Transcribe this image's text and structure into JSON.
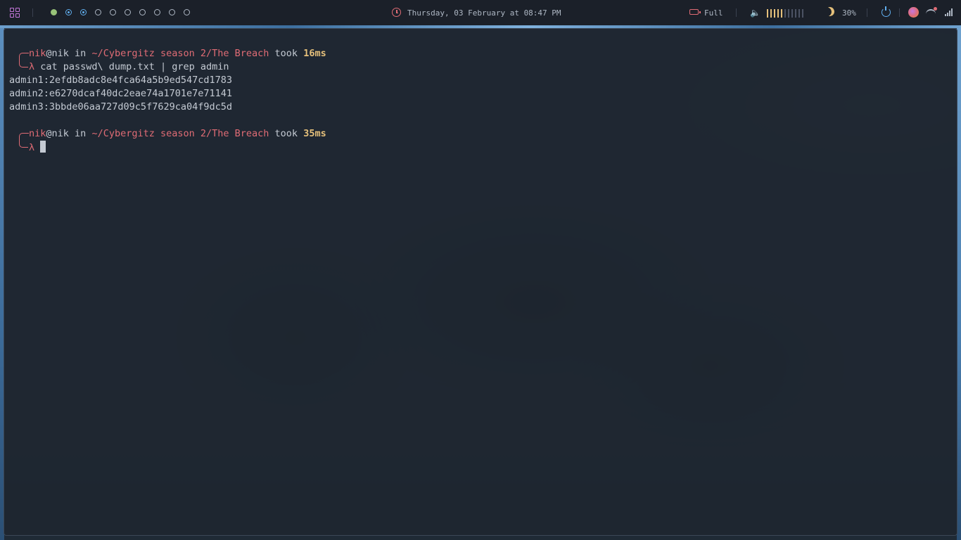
{
  "topbar": {
    "workspaces": [
      "occupied",
      "active",
      "active",
      "empty",
      "empty",
      "empty",
      "empty",
      "empty",
      "empty",
      "empty"
    ],
    "datetime": "Thursday, 03 February at 08:47 PM",
    "battery_label": "Full",
    "volume_level": 0.45,
    "brightness_label": "30%",
    "icons": {
      "launcher": "grid-icon",
      "clock": "clock-icon",
      "battery": "battery-charging-icon",
      "volume": "speaker-icon",
      "brightness": "moon-icon",
      "power": "power-icon",
      "browser": "firefox-icon",
      "network": "wifi-icon",
      "signal": "signal-icon"
    },
    "colors": {
      "accent_red": "#e06c75",
      "accent_blue": "#61afef",
      "accent_yellow": "#e5c07b",
      "accent_green": "#98c379",
      "accent_purple": "#c678dd"
    }
  },
  "terminal": {
    "prompt1": {
      "user": "nik",
      "at": "@",
      "host": "nik",
      "in_text": " in ",
      "path": "~/Cybergitz season 2/The Breach",
      "took_text": " took ",
      "duration": "16ms"
    },
    "command_symbol": "λ",
    "command1": " cat passwd\\ dump.txt | grep admin",
    "output": [
      "admin1:2efdb8adc8e4fca64a5b9ed547cd1783",
      "admin2:e6270dcaf40dc2eae74a1701e7e71141",
      "admin3:3bbde06aa727d09c5f7629ca04f9dc5d"
    ],
    "prompt2": {
      "user": "nik",
      "at": "@",
      "host": "nik",
      "in_text": " in ",
      "path": "~/Cybergitz season 2/The Breach",
      "took_text": " took ",
      "duration": "35ms"
    }
  }
}
